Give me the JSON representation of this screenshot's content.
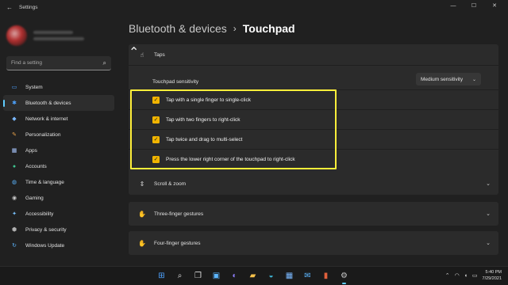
{
  "window": {
    "title": "Settings",
    "controls": [
      "—",
      "☐",
      "✕"
    ]
  },
  "sidebar": {
    "search_placeholder": "Find a setting",
    "items": [
      {
        "label": "System",
        "icon": "system-icon",
        "glyph": "▭",
        "color": "#4da3ff"
      },
      {
        "label": "Bluetooth & devices",
        "icon": "bluetooth-icon",
        "glyph": "✱",
        "color": "#4da3ff",
        "active": true
      },
      {
        "label": "Network & internet",
        "icon": "network-icon",
        "glyph": "◆",
        "color": "#7ab8ff"
      },
      {
        "label": "Personalization",
        "icon": "brush-icon",
        "glyph": "✎",
        "color": "#e5a04a"
      },
      {
        "label": "Apps",
        "icon": "apps-icon",
        "glyph": "▦",
        "color": "#a9c6ff"
      },
      {
        "label": "Accounts",
        "icon": "person-icon",
        "glyph": "●",
        "color": "#3fc48f"
      },
      {
        "label": "Time & language",
        "icon": "globe-clock-icon",
        "glyph": "◍",
        "color": "#5cb6ff"
      },
      {
        "label": "Gaming",
        "icon": "gamepad-icon",
        "glyph": "◉",
        "color": "#c9c9c9"
      },
      {
        "label": "Accessibility",
        "icon": "accessibility-icon",
        "glyph": "✦",
        "color": "#7ac3ff"
      },
      {
        "label": "Privacy & security",
        "icon": "shield-icon",
        "glyph": "⬢",
        "color": "#b0b0b0"
      },
      {
        "label": "Windows Update",
        "icon": "update-icon",
        "glyph": "↻",
        "color": "#5cb6ff"
      }
    ]
  },
  "main": {
    "breadcrumb": {
      "parent": "Bluetooth & devices",
      "separator": "›",
      "current": "Touchpad"
    },
    "taps": {
      "label": "Taps",
      "sensitivity_label": "Touchpad sensitivity",
      "sensitivity_value": "Medium sensitivity",
      "options": [
        "Tap with a single finger to single-click",
        "Tap with two fingers to right-click",
        "Tap twice and drag to multi-select",
        "Press the lower right corner of the touchpad to right-click"
      ]
    },
    "sections": [
      {
        "label": "Scroll & zoom"
      },
      {
        "label": "Three-finger gestures"
      },
      {
        "label": "Four-finger gestures"
      }
    ]
  },
  "taskbar": {
    "icons": [
      {
        "name": "start-icon",
        "glyph": "⊞",
        "color": "#4da3ff"
      },
      {
        "name": "search-icon",
        "glyph": "⌕",
        "color": "#e0e0e0"
      },
      {
        "name": "task-view-icon",
        "glyph": "❐",
        "color": "#e0e0e0"
      },
      {
        "name": "widgets-icon",
        "glyph": "▣",
        "color": "#5cb6ff"
      },
      {
        "name": "chat-icon",
        "glyph": "◐",
        "color": "#8b7cf6"
      },
      {
        "name": "file-explorer-icon",
        "glyph": "▰",
        "color": "#f5c04a"
      },
      {
        "name": "edge-icon",
        "glyph": "◒",
        "color": "#3fb6d6"
      },
      {
        "name": "store-icon",
        "glyph": "▦",
        "color": "#7ab8ff"
      },
      {
        "name": "mail-icon",
        "glyph": "✉",
        "color": "#5cb6ff"
      },
      {
        "name": "office-icon",
        "glyph": "▮",
        "color": "#e0603c"
      },
      {
        "name": "settings-icon",
        "glyph": "⚙",
        "color": "#c9c9c9",
        "active": true
      }
    ],
    "time": "5:40 PM",
    "date": "7/29/2021"
  },
  "colors": {
    "accent": "#60cdff",
    "checkbox": "#f0b400",
    "highlight_box": "#ffef3a"
  }
}
